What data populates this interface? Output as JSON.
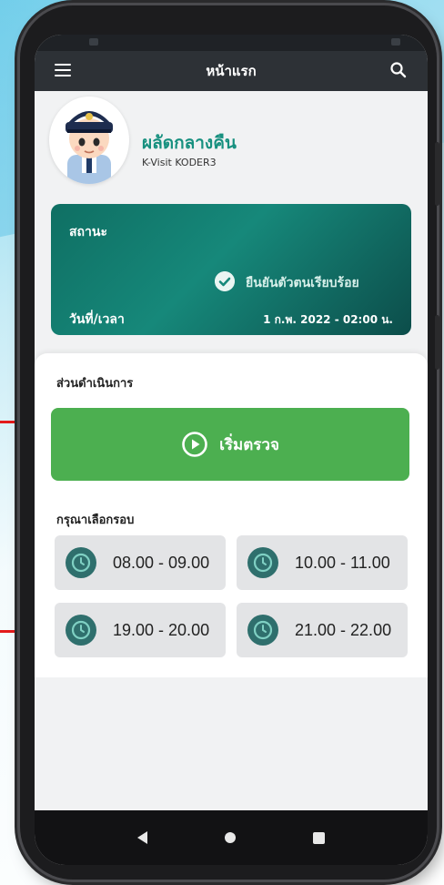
{
  "appbar": {
    "title": "หน้าแรก",
    "menu_icon": "hamburger-menu-icon",
    "search_icon": "search-icon"
  },
  "profile": {
    "name": "ผลัดกลางคืน",
    "subtitle": "K-Visit KODER3",
    "avatar": "security-guard-avatar"
  },
  "status_card": {
    "status_label": "สถานะ",
    "status_value": "ยืนยันตัวตนเรียบร้อย",
    "datetime_label": "วันที่/เวลา",
    "datetime_value": "1 ก.พ. 2022 - 02:00 น."
  },
  "actions": {
    "title": "ส่วนดำเนินการ",
    "start_button": "เริ่มตรวจ",
    "start_icon": "play-circle-icon"
  },
  "rounds": {
    "title": "กรุณาเลือกรอบ",
    "slots": [
      "08.00 - 09.00",
      "10.00 - 11.00",
      "19.00 - 20.00",
      "21.00 - 22.00"
    ]
  },
  "colors": {
    "accent": "#17907f",
    "start_green": "#4caf50",
    "card_teal": "#16887a",
    "annotation_red": "#e31b1b"
  }
}
